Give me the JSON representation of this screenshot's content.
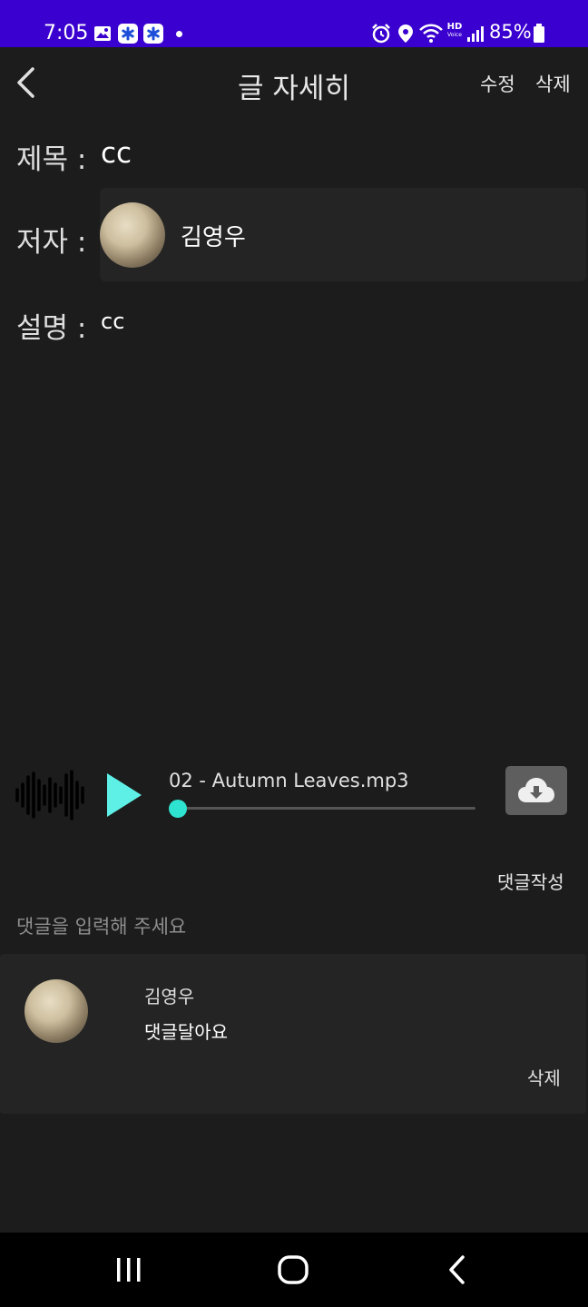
{
  "status_bar": {
    "time": "7:05",
    "battery": "85%",
    "hd_label": "HD",
    "voice_label": "Voice"
  },
  "header": {
    "title": "글 자세히",
    "edit_label": "수정",
    "delete_label": "삭제"
  },
  "post": {
    "title_label": "제목 :",
    "title_value": "cc",
    "author_label": "저자 :",
    "author_name": "김영우",
    "description_label": "설명 :",
    "description_value": "cc"
  },
  "player": {
    "track_name": "02 - Autumn Leaves.mp3",
    "progress": 0,
    "accent_color": "#2ee3cf"
  },
  "comments": {
    "write_label": "댓글작성",
    "input_placeholder": "댓글을 입력해 주세요",
    "input_value": "",
    "items": [
      {
        "author": "김영우",
        "text": "댓글달아요",
        "delete_label": "삭제"
      }
    ]
  },
  "nav_bar": {
    "icons": [
      "recent-apps-icon",
      "home-icon",
      "back-icon"
    ]
  },
  "colors": {
    "status_bar": "#3a00cf",
    "background": "#1c1c1c",
    "card": "#242424"
  }
}
